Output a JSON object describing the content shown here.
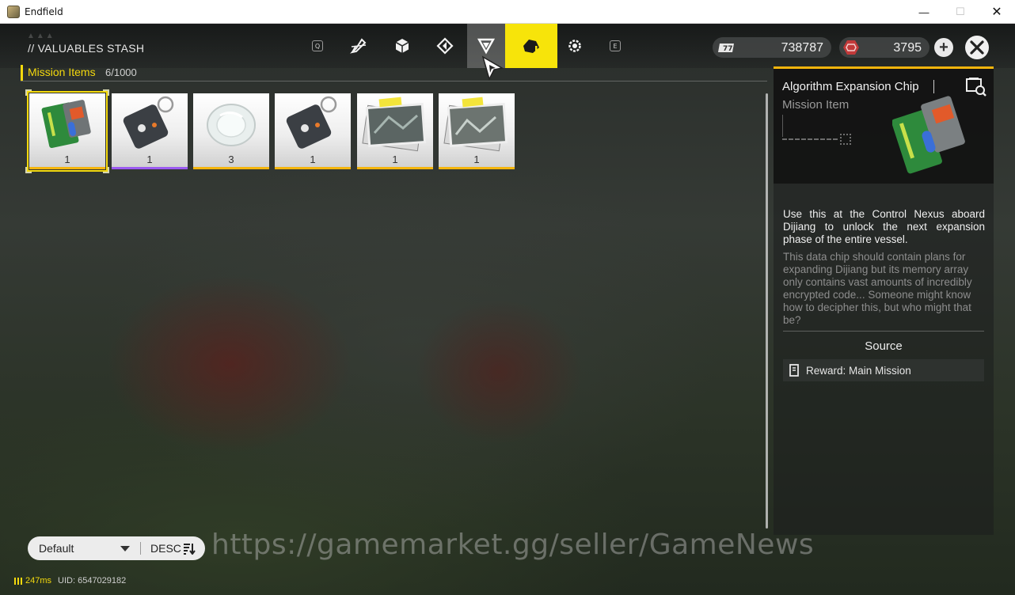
{
  "window": {
    "title": "Endfield",
    "minimize_glyph": "—",
    "maximize_glyph": "☐",
    "close_glyph": "✕"
  },
  "header": {
    "section_title": "// VALUABLES STASH",
    "prev_key": "Q",
    "next_key": "E",
    "tabs": [
      {
        "icon": "pen-tool-icon",
        "state": "normal"
      },
      {
        "icon": "cube-icon",
        "state": "normal"
      },
      {
        "icon": "diamond-arrow-icon",
        "state": "normal"
      },
      {
        "icon": "triangle-icon",
        "state": "hover"
      },
      {
        "icon": "mission-box-icon",
        "state": "active"
      },
      {
        "icon": "gear-icon",
        "state": "normal"
      }
    ],
    "currencies": [
      {
        "icon": "ticket-icon",
        "amount": "738787"
      },
      {
        "icon": "origeometry-icon",
        "amount": "3795"
      }
    ]
  },
  "category": {
    "label": "Mission Items",
    "count": "6/1000"
  },
  "items": [
    {
      "art": "data-chip",
      "qty": "1",
      "rarity_color": "#f4b50d",
      "selected": true
    },
    {
      "art": "keytag",
      "qty": "1",
      "rarity_color": "#9b59f0",
      "selected": false
    },
    {
      "art": "crystal",
      "qty": "3",
      "rarity_color": "#f4b50d",
      "selected": false
    },
    {
      "art": "keytag",
      "qty": "1",
      "rarity_color": "#f4b50d",
      "selected": false
    },
    {
      "art": "photos",
      "qty": "1",
      "rarity_color": "#f4b50d",
      "selected": false
    },
    {
      "art": "photos",
      "qty": "1",
      "rarity_color": "#f4b50d",
      "selected": false
    }
  ],
  "detail": {
    "name": "Algorithm Expansion Chip",
    "type": "Mission Item",
    "description": "Use this at the Control Nexus aboard Dijiang to unlock the next expansion phase of the entire vessel.",
    "flavor": "This data chip should contain plans for expanding Dijiang but its memory array only contains vast amounts of incredibly encrypted code... Someone might know how to decipher this, but who might that be?",
    "source_title": "Source",
    "source_entry": "Reward: Main Mission",
    "accent_color": "#f4b50d"
  },
  "sort": {
    "selected": "Default",
    "order": "DESC"
  },
  "watermark": "https://gamemarket.gg/seller/GameNews",
  "status": {
    "ping": "247ms",
    "uid": "UID: 6547029182"
  }
}
